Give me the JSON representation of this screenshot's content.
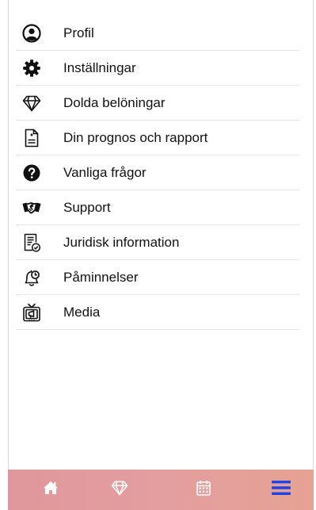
{
  "menu": {
    "items": [
      {
        "label": "Profil",
        "icon": "profile-icon"
      },
      {
        "label": "Inställningar",
        "icon": "gear-icon"
      },
      {
        "label": "Dolda belöningar",
        "icon": "diamond-icon"
      },
      {
        "label": "Din prognos och rapport",
        "icon": "document-icon"
      },
      {
        "label": "Vanliga frågor",
        "icon": "question-icon"
      },
      {
        "label": "Support",
        "icon": "handshake-icon"
      },
      {
        "label": "Juridisk information",
        "icon": "legal-document-icon"
      },
      {
        "label": "Påminnelser",
        "icon": "bell-icon"
      },
      {
        "label": "Media",
        "icon": "tv-icon"
      }
    ]
  },
  "bottom_nav": {
    "items": [
      {
        "icon": "home-icon",
        "active": false
      },
      {
        "icon": "diamond-icon",
        "active": false
      },
      {
        "icon": "calendar-icon",
        "active": false
      },
      {
        "icon": "hamburger-menu-icon",
        "active": true
      }
    ],
    "active_color": "#1a44e8",
    "inactive_color": "#ffffff"
  }
}
